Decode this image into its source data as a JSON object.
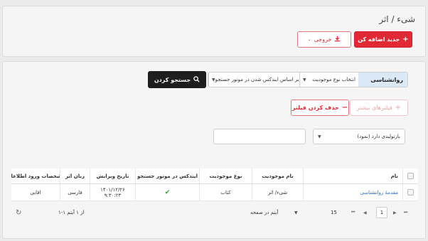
{
  "header": {
    "title": "شیء / اثر",
    "add_new_label": "جدید اضافه کن",
    "export_label": "خروجی"
  },
  "search": {
    "term": "روانشناسی",
    "entity_type_select": "انتخاب نوع موجودیت",
    "index_select": "بر اساس ایندکس شدن در موتور جستجو",
    "search_button": "جستجو کردن"
  },
  "filters": {
    "more_filters": "فیلترهای بیشتر",
    "remove_filter": "حذف کردن فیلتر",
    "filter_field_value": "بازتولیدی دارد (نمود)",
    "filter_value_input": ""
  },
  "table": {
    "columns": [
      "نام",
      "نام موجودیت",
      "نوع موجودیت",
      "ایندکس در موتور جستجو",
      "تاریخ ویرایش",
      "زبان اثر",
      "مشخصات ورود اطلاعات"
    ],
    "rows": [
      {
        "name": "مقدمهٔ روانشناسی",
        "entity_name": "شیء/ اثر",
        "entity_type": "کتاب",
        "indexed": "✔",
        "edit_date": "۱۴۰۱/۱۲/۲۶",
        "edit_time": "۹:۳۰:۲۳",
        "language": "فارسی",
        "entry_info": "اقایی"
      }
    ]
  },
  "pagination": {
    "current_page": "1",
    "per_page": "15",
    "per_page_label": "آیتم در صفحه",
    "range_text": "۱-۱ از ۱ آیتم"
  },
  "colors": {
    "primary": "#e02935",
    "dark": "#1e1e1e",
    "term_bg": "#dbe9f6",
    "link": "#2a6fc9",
    "check": "#2a9d2a"
  }
}
